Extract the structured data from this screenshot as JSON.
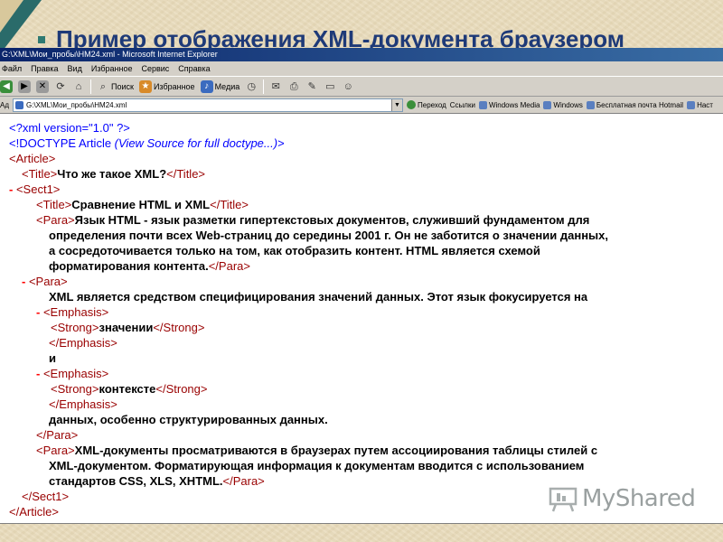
{
  "slide": {
    "title": "Пример отображения XML-документа браузером"
  },
  "window": {
    "title": "G:\\XML\\Мои_пробы\\HM24.xml - Microsoft Internet Explorer",
    "menu": [
      "Файл",
      "Правка",
      "Вид",
      "Избранное",
      "Сервис",
      "Справка"
    ],
    "toolbar": {
      "search": "Поиск",
      "favorites": "Избранное",
      "media": "Медиа"
    },
    "address": {
      "label": "Адрес",
      "value": "G:\\XML\\Мои_пробы\\HM24.xml",
      "go": "Переход",
      "links": "Ссылки"
    },
    "links": [
      "Windows Media",
      "Windows",
      "Бесплатная почта Hotmail",
      "Наст"
    ]
  },
  "xml": {
    "decl": "<?xml version=\"1.0\" ?>",
    "doctype_open": "<!DOCTYPE Article ",
    "doctype_note": "(View Source for full doctype...)",
    "doctype_close": ">",
    "article_open": "<Article>",
    "title_open": "<Title>",
    "title_text": "Что же такое XML?",
    "title_close": "</Title>",
    "sect_open": "<Sect1>",
    "sect_title_text": "Сравнение HTML и XML",
    "para_open": "<Para>",
    "para_close": "</Para>",
    "para1_l1": "Язык HTML - язык разметки гипертекстовых документов, служивший фундаментом для",
    "para1_l2": "определения почти всех Web-страниц до середины 2001 г. Он не заботится о значении данных,",
    "para1_l3": "а сосредоточивается только на том, как отобразить контент. HTML является схемой",
    "para1_l4": "форматирования контента.",
    "para2_text": "XML является средством специфицирования значений данных. Этот язык фокусируется на",
    "emphasis_open": "<Emphasis>",
    "emphasis_close": "</Emphasis>",
    "strong_open": "<Strong>",
    "strong_close": "</Strong>",
    "strong1": "значении",
    "and_text": "и",
    "strong2": "контексте",
    "para2_end": "данных, особенно структурированных данных.",
    "para3_l1": "XML-документы просматриваются в браузерах путем ассоциирования таблицы стилей с",
    "para3_l2": "XML-документом. Форматирующая информация к документам вводится с использованием",
    "para3_l3": "стандартов CSS, XLS, XHTML.",
    "sect_close": "</Sect1>",
    "article_close": "</Article>",
    "minus": "-"
  },
  "watermark": "MyShared"
}
